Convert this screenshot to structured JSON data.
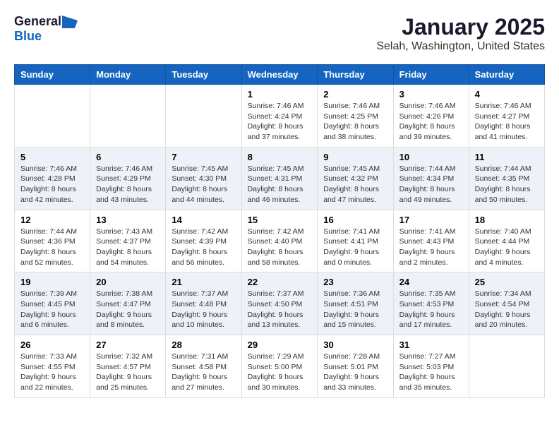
{
  "header": {
    "logo_general": "General",
    "logo_blue": "Blue",
    "month_title": "January 2025",
    "location": "Selah, Washington, United States"
  },
  "weekdays": [
    "Sunday",
    "Monday",
    "Tuesday",
    "Wednesday",
    "Thursday",
    "Friday",
    "Saturday"
  ],
  "weeks": [
    [
      {
        "day": "",
        "content": ""
      },
      {
        "day": "",
        "content": ""
      },
      {
        "day": "",
        "content": ""
      },
      {
        "day": "1",
        "content": "Sunrise: 7:46 AM\nSunset: 4:24 PM\nDaylight: 8 hours and 37 minutes."
      },
      {
        "day": "2",
        "content": "Sunrise: 7:46 AM\nSunset: 4:25 PM\nDaylight: 8 hours and 38 minutes."
      },
      {
        "day": "3",
        "content": "Sunrise: 7:46 AM\nSunset: 4:26 PM\nDaylight: 8 hours and 39 minutes."
      },
      {
        "day": "4",
        "content": "Sunrise: 7:46 AM\nSunset: 4:27 PM\nDaylight: 8 hours and 41 minutes."
      }
    ],
    [
      {
        "day": "5",
        "content": "Sunrise: 7:46 AM\nSunset: 4:28 PM\nDaylight: 8 hours and 42 minutes."
      },
      {
        "day": "6",
        "content": "Sunrise: 7:46 AM\nSunset: 4:29 PM\nDaylight: 8 hours and 43 minutes."
      },
      {
        "day": "7",
        "content": "Sunrise: 7:45 AM\nSunset: 4:30 PM\nDaylight: 8 hours and 44 minutes."
      },
      {
        "day": "8",
        "content": "Sunrise: 7:45 AM\nSunset: 4:31 PM\nDaylight: 8 hours and 46 minutes."
      },
      {
        "day": "9",
        "content": "Sunrise: 7:45 AM\nSunset: 4:32 PM\nDaylight: 8 hours and 47 minutes."
      },
      {
        "day": "10",
        "content": "Sunrise: 7:44 AM\nSunset: 4:34 PM\nDaylight: 8 hours and 49 minutes."
      },
      {
        "day": "11",
        "content": "Sunrise: 7:44 AM\nSunset: 4:35 PM\nDaylight: 8 hours and 50 minutes."
      }
    ],
    [
      {
        "day": "12",
        "content": "Sunrise: 7:44 AM\nSunset: 4:36 PM\nDaylight: 8 hours and 52 minutes."
      },
      {
        "day": "13",
        "content": "Sunrise: 7:43 AM\nSunset: 4:37 PM\nDaylight: 8 hours and 54 minutes."
      },
      {
        "day": "14",
        "content": "Sunrise: 7:42 AM\nSunset: 4:39 PM\nDaylight: 8 hours and 56 minutes."
      },
      {
        "day": "15",
        "content": "Sunrise: 7:42 AM\nSunset: 4:40 PM\nDaylight: 8 hours and 58 minutes."
      },
      {
        "day": "16",
        "content": "Sunrise: 7:41 AM\nSunset: 4:41 PM\nDaylight: 9 hours and 0 minutes."
      },
      {
        "day": "17",
        "content": "Sunrise: 7:41 AM\nSunset: 4:43 PM\nDaylight: 9 hours and 2 minutes."
      },
      {
        "day": "18",
        "content": "Sunrise: 7:40 AM\nSunset: 4:44 PM\nDaylight: 9 hours and 4 minutes."
      }
    ],
    [
      {
        "day": "19",
        "content": "Sunrise: 7:39 AM\nSunset: 4:45 PM\nDaylight: 9 hours and 6 minutes."
      },
      {
        "day": "20",
        "content": "Sunrise: 7:38 AM\nSunset: 4:47 PM\nDaylight: 9 hours and 8 minutes."
      },
      {
        "day": "21",
        "content": "Sunrise: 7:37 AM\nSunset: 4:48 PM\nDaylight: 9 hours and 10 minutes."
      },
      {
        "day": "22",
        "content": "Sunrise: 7:37 AM\nSunset: 4:50 PM\nDaylight: 9 hours and 13 minutes."
      },
      {
        "day": "23",
        "content": "Sunrise: 7:36 AM\nSunset: 4:51 PM\nDaylight: 9 hours and 15 minutes."
      },
      {
        "day": "24",
        "content": "Sunrise: 7:35 AM\nSunset: 4:53 PM\nDaylight: 9 hours and 17 minutes."
      },
      {
        "day": "25",
        "content": "Sunrise: 7:34 AM\nSunset: 4:54 PM\nDaylight: 9 hours and 20 minutes."
      }
    ],
    [
      {
        "day": "26",
        "content": "Sunrise: 7:33 AM\nSunset: 4:55 PM\nDaylight: 9 hours and 22 minutes."
      },
      {
        "day": "27",
        "content": "Sunrise: 7:32 AM\nSunset: 4:57 PM\nDaylight: 9 hours and 25 minutes."
      },
      {
        "day": "28",
        "content": "Sunrise: 7:31 AM\nSunset: 4:58 PM\nDaylight: 9 hours and 27 minutes."
      },
      {
        "day": "29",
        "content": "Sunrise: 7:29 AM\nSunset: 5:00 PM\nDaylight: 9 hours and 30 minutes."
      },
      {
        "day": "30",
        "content": "Sunrise: 7:28 AM\nSunset: 5:01 PM\nDaylight: 9 hours and 33 minutes."
      },
      {
        "day": "31",
        "content": "Sunrise: 7:27 AM\nSunset: 5:03 PM\nDaylight: 9 hours and 35 minutes."
      },
      {
        "day": "",
        "content": ""
      }
    ]
  ]
}
